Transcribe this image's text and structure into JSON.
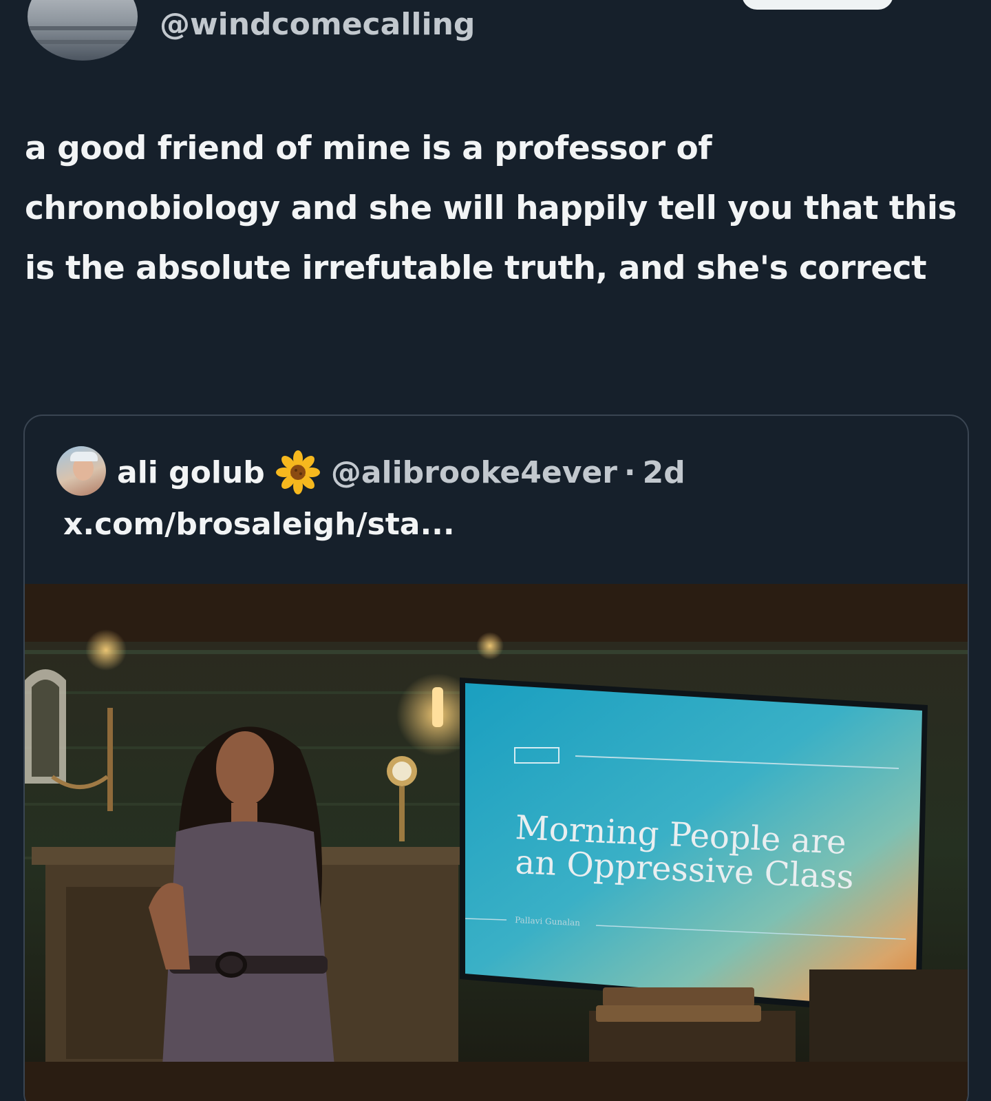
{
  "tweet": {
    "handle": "@windcomecalling",
    "text": "a good friend of mine is a professor of chronobiology and she will happily tell you that this is the absolute irrefutable truth, and she's correct"
  },
  "quoted_tweet": {
    "author_name": "ali golub",
    "author_emoji_icon": "sunflower-icon",
    "handle": "@alibrooke4ever",
    "separator": "·",
    "time": "2d",
    "link_text": "x.com/brosaleigh/sta...",
    "media": {
      "slide_title_line1": "Morning People are",
      "slide_title_line2": "an Oppressive Class",
      "slide_byline": "Pallavi Gunalan"
    }
  },
  "colors": {
    "background": "#16202b",
    "primary_text": "#f2f4f5",
    "secondary_text": "#c2c8ce",
    "card_border": "#3a4552",
    "slide_teal": "#1aa3c2"
  }
}
